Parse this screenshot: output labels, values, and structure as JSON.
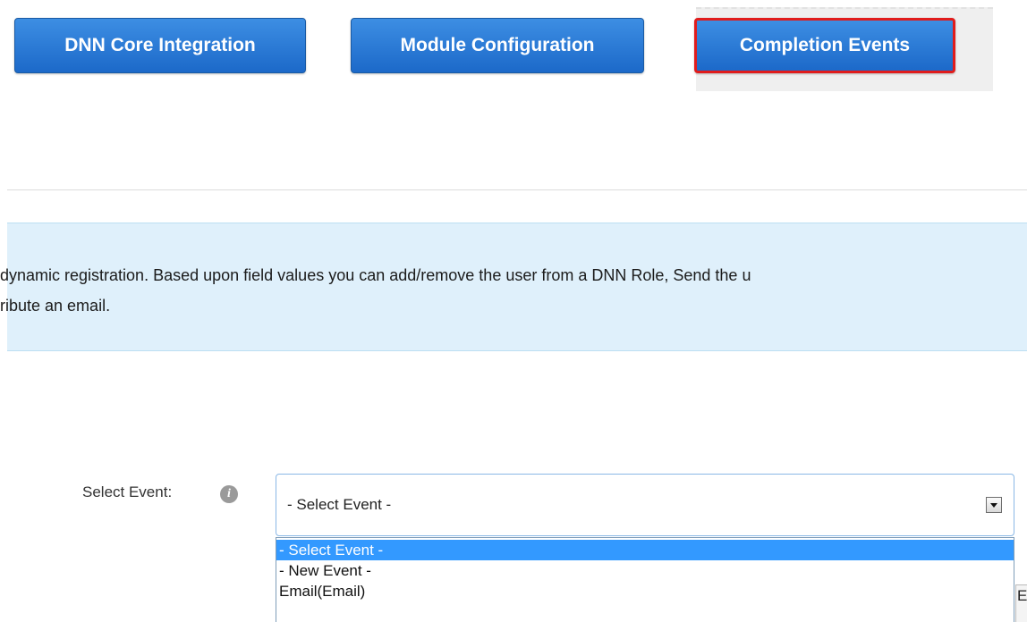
{
  "tabs": [
    {
      "label": "DNN Core Integration"
    },
    {
      "label": "Module Configuration"
    },
    {
      "label": "Completion Events"
    }
  ],
  "info": {
    "line1": "dynamic registration. Based upon field values you can add/remove the user from a DNN Role, Send the u",
    "line2": "ribute an email."
  },
  "event_select": {
    "label": "Select Event:",
    "value": "- Select Event -",
    "options": [
      "- Select Event -",
      "- New Event -",
      "Email(Email)"
    ]
  },
  "partial_control": {
    "text": "E"
  },
  "colors": {
    "tab_blue": "#2a7bd8",
    "highlight_border": "#e01c1c",
    "info_background": "#dff0fb",
    "selected_option": "#3399ff"
  },
  "icons": {
    "info": "info-circle-icon",
    "dropdown": "chevron-down-icon"
  }
}
